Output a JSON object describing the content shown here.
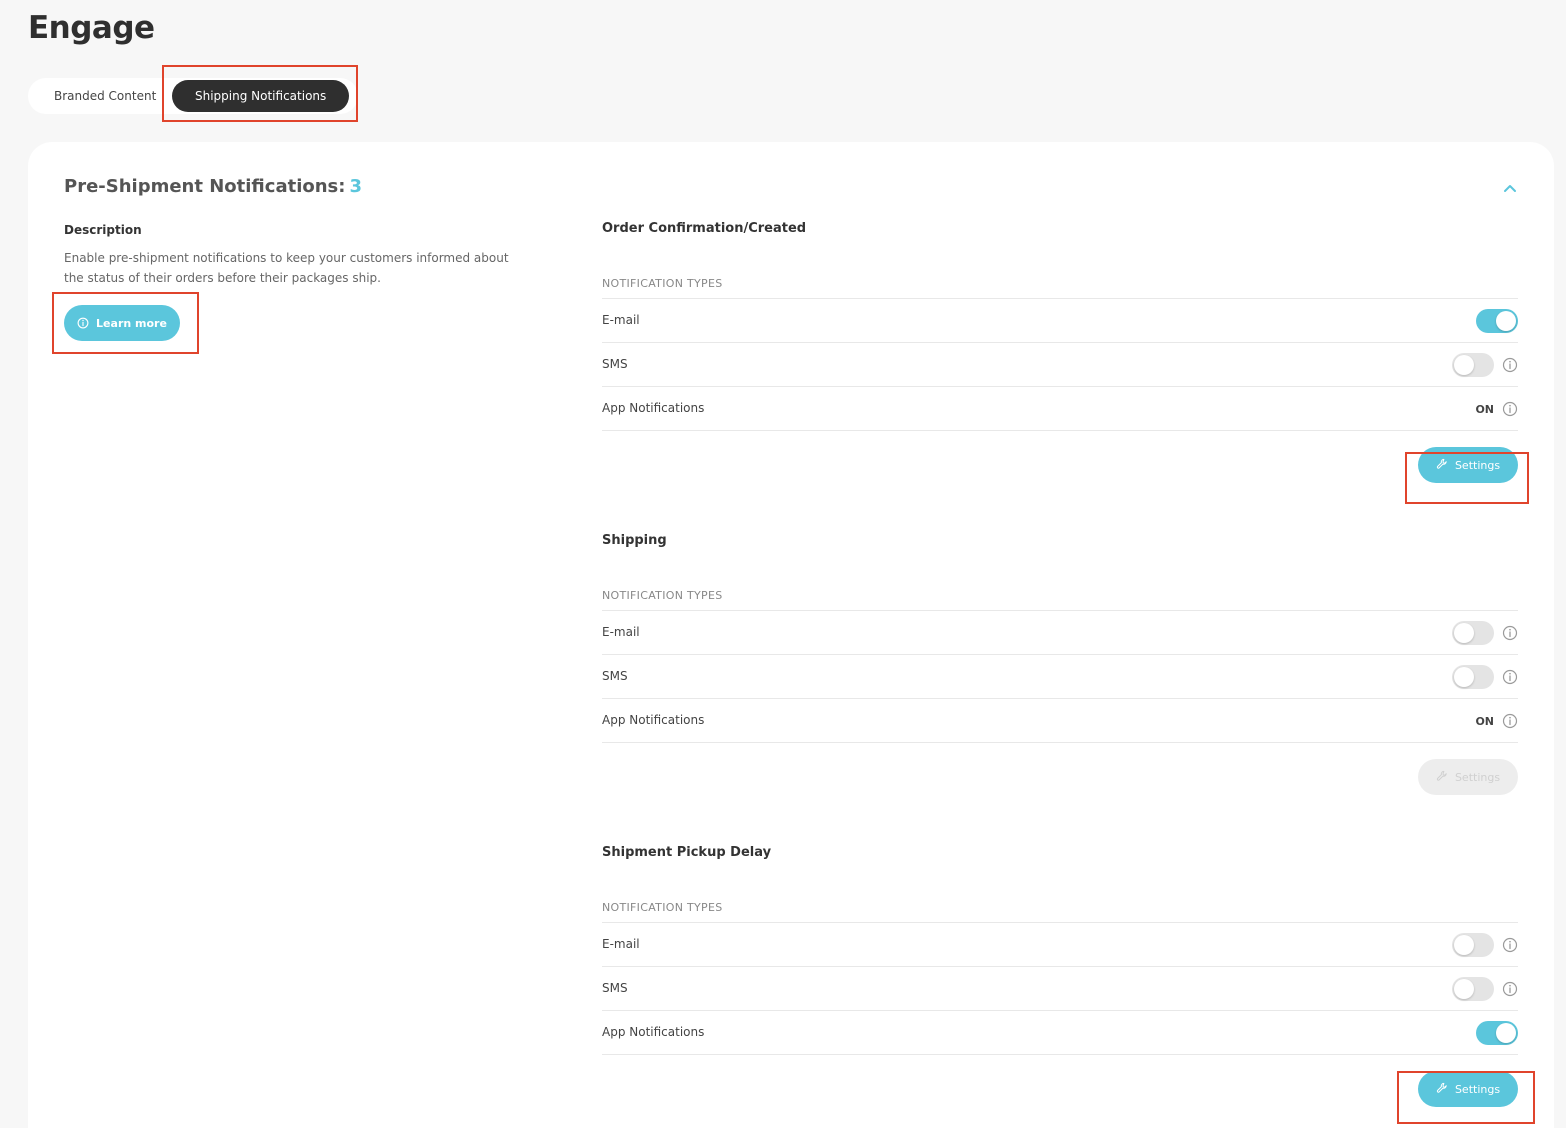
{
  "page": {
    "title": "Engage"
  },
  "tabs": [
    {
      "label": "Branded Content",
      "active": false
    },
    {
      "label": "Shipping Notifications",
      "active": true
    }
  ],
  "section": {
    "title": "Pre-Shipment Notifications:",
    "count": "3",
    "collapse_icon": "chevron-up-icon",
    "description_label": "Description",
    "description": "Enable pre-shipment notifications to keep your customers informed about the status of their orders before their packages ship.",
    "learn_more_label": "Learn more"
  },
  "groups": [
    {
      "title": "Order Confirmation/Created",
      "types_label": "NOTIFICATION TYPES",
      "rows": [
        {
          "label": "E-mail",
          "toggle": true,
          "info": false
        },
        {
          "label": "SMS",
          "toggle": false,
          "info": true
        },
        {
          "label": "App Notifications",
          "status_text": "ON",
          "info": true
        }
      ],
      "settings_label": "Settings",
      "settings_enabled": true
    },
    {
      "title": "Shipping",
      "types_label": "NOTIFICATION TYPES",
      "rows": [
        {
          "label": "E-mail",
          "toggle": false,
          "info": true
        },
        {
          "label": "SMS",
          "toggle": false,
          "info": true
        },
        {
          "label": "App Notifications",
          "status_text": "ON",
          "info": true
        }
      ],
      "settings_label": "Settings",
      "settings_enabled": false
    },
    {
      "title": "Shipment Pickup Delay",
      "types_label": "NOTIFICATION TYPES",
      "rows": [
        {
          "label": "E-mail",
          "toggle": false,
          "info": true
        },
        {
          "label": "SMS",
          "toggle": false,
          "info": true
        },
        {
          "label": "App Notifications",
          "toggle": true,
          "info": false
        }
      ],
      "settings_label": "Settings",
      "settings_enabled": true
    }
  ],
  "colors": {
    "accent": "#5bc6dc",
    "dark_tab": "#2f2f2f",
    "highlight": "#e0442c",
    "toggle_off": "#e4e4e4"
  }
}
